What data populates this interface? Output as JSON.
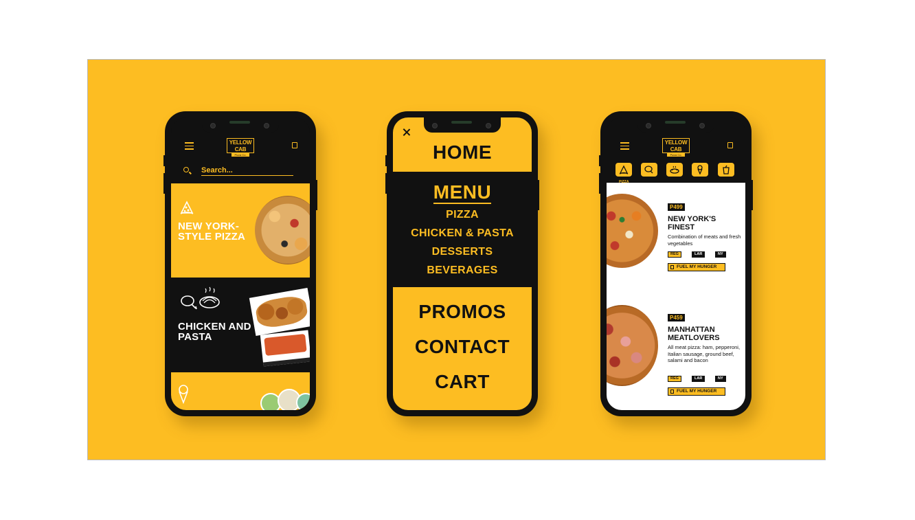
{
  "phone_home": {
    "logo": {
      "line1": "YELLOW CAB",
      "line2": "Pizza Co."
    },
    "search": {
      "placeholder": "Search..."
    },
    "cards": [
      {
        "title": "NEW YORK-STYLE PIZZA"
      },
      {
        "title": "CHICKEN AND PASTA"
      },
      {
        "title": ""
      }
    ]
  },
  "phone_menu": {
    "items": {
      "home": "HOME",
      "menu": "MENU",
      "pizza": "PIZZA",
      "chicken_pasta": "CHICKEN & PASTA",
      "desserts": "DESSERTS",
      "beverages": "BEVERAGES",
      "promos": "PROMOS",
      "contact": "CONTACT",
      "cart": "CART"
    }
  },
  "phone_products": {
    "logo": {
      "line1": "YELLOW CAB",
      "line2": "Pizza Co."
    },
    "categories": [
      {
        "icon": "pizza-slice-icon",
        "label": "PIZZA",
        "active": true
      },
      {
        "icon": "chicken-icon",
        "label": "",
        "active": false
      },
      {
        "icon": "pasta-icon",
        "label": "",
        "active": false
      },
      {
        "icon": "ice-cream-icon",
        "label": "",
        "active": false
      },
      {
        "icon": "drink-icon",
        "label": "",
        "active": false
      }
    ],
    "products": [
      {
        "price": "P499",
        "name": "NEW YORK'S FINEST",
        "description": "Combination of meats and fresh vegetables",
        "sizes": [
          "REG",
          "LAR",
          "NY"
        ],
        "selected_size": "REG",
        "cta": "FUEL MY HUNGER"
      },
      {
        "price": "P459",
        "name": "MANHATTAN MEATLOVERS",
        "description": "All meat pizza: ham, pepperoni, Italian sausage, ground beef, salami and bacon",
        "sizes": [
          "REG",
          "LAR",
          "NY"
        ],
        "selected_size": "REG",
        "cta": "FUEL MY HUNGER"
      }
    ]
  },
  "colors": {
    "brand_yellow": "#fdbd22",
    "brand_black": "#111111",
    "white": "#ffffff"
  }
}
